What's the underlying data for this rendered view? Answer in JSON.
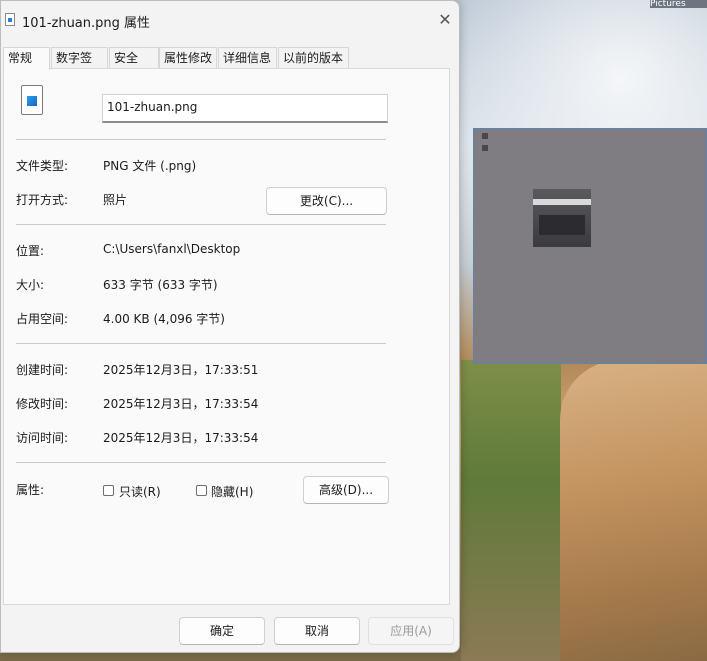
{
  "desktop_clip_text": "Pictures",
  "dialog": {
    "title": "101-zhuan.png 属性",
    "close_glyph": "✕"
  },
  "tabs": [
    {
      "label": "常规"
    },
    {
      "label": "数字签名"
    },
    {
      "label": "安全"
    },
    {
      "label": "属性修改"
    },
    {
      "label": "详细信息"
    },
    {
      "label": "以前的版本"
    }
  ],
  "general": {
    "filename": "101-zhuan.png",
    "file_type_label": "文件类型:",
    "file_type_value": "PNG 文件 (.png)",
    "open_with_label": "打开方式:",
    "open_with_value": "照片",
    "change_button": "更改(C)...",
    "location_label": "位置:",
    "location_value": "C:\\Users\\fanxl\\Desktop",
    "size_label": "大小:",
    "size_value": "633 字节 (633 字节)",
    "disk_size_label": "占用空间:",
    "disk_size_value": "4.00 KB (4,096 字节)",
    "created_label": "创建时间:",
    "created_value": "2025年12月3日，17:33:51",
    "modified_label": "修改时间:",
    "modified_value": "2025年12月3日，17:33:54",
    "accessed_label": "访问时间:",
    "accessed_value": "2025年12月3日，17:33:54",
    "attributes_label": "属性:",
    "readonly_label": "只读(R)",
    "hidden_label": "隐藏(H)",
    "advanced_button": "高级(D)..."
  },
  "footer": {
    "ok": "确定",
    "cancel": "取消",
    "apply": "应用(A)"
  }
}
